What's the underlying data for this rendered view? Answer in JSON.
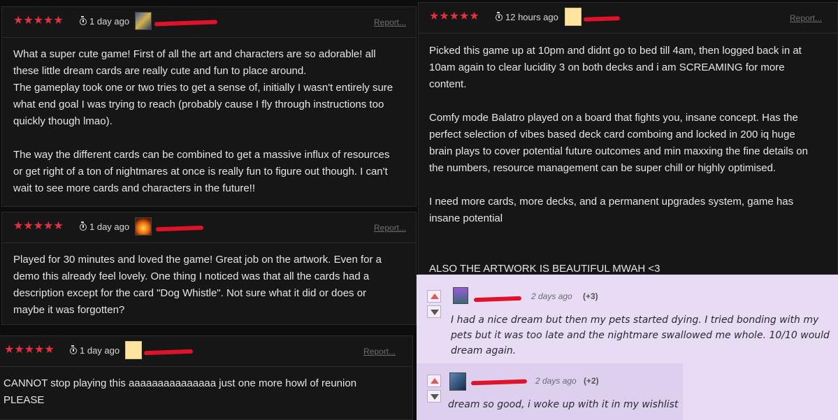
{
  "reviews": [
    {
      "stars": "★★★★★",
      "time": "1 day ago",
      "report": "Report...",
      "body": "What a super cute game! First of all the art and characters are so adorable! all\nthese little dream cards are really cute and fun to place around.\nThe gameplay took one or two tries to get a sense of, initially I wasn't entirely sure\nwhat end goal I was trying to reach (probably cause I fly through instructions too\nquickly though lmao).\n\nThe way the different cards can be combined to get a massive influx of resources\nor get right of a ton of nightmares at once is really fun to figure out though. I can't\nwait to see more cards and characters in the future!!"
    },
    {
      "stars": "★★★★★",
      "time": "1 day ago",
      "report": "Report...",
      "body": "Played for 30 minutes and loved the game! Great job on the artwork. Even for a\ndemo this already feel lovely. One thing I noticed was that all the cards had a\ndescription except for the card \"Dog Whistle\". Not sure what it did or does or\nmaybe it was forgotten?"
    },
    {
      "stars": "★★★★★",
      "time": "1 day ago",
      "report": "Report...",
      "body": "CANNOT stop playing this aaaaaaaaaaaaaaa just one more howl of reunion\nPLEASE"
    },
    {
      "stars": "★★★★★",
      "time": "12 hours ago",
      "report": "Report...",
      "body": "Picked this game up at 10pm and didnt go to bed till 4am, then logged back in at\n10am again to clear lucidity 3 on both decks and i am SCREAMING for more\ncontent.\n\nComfy mode Balatro played on a board that fights you, insane concept. Has the\nperfect selection of vibes based deck card comboing and locked in 200 iq huge\nbrain plays to cover potential future outcomes and min maxxing the fine details on\nthe numbers, resource management can be super chill or highly optimised.\n\nI need more cards, more decks, and a permanent upgrades system, game has\ninsane potential\n\n\nALSO THE ARTWORK IS BEAUTIFUL MWAH <3"
    }
  ],
  "comments": [
    {
      "time": "2 days ago",
      "score": "(+3)",
      "text": "I had a nice dream but then my pets started dying. I tried bonding with my\npets but it was too late and the nightmare swallowed me whole. 10/10 would\ndream again."
    },
    {
      "time": "2 days ago",
      "score": "(+2)",
      "text": "dream so good, i woke up with it in my wishlist"
    }
  ],
  "colors": {
    "star": "#e5303f",
    "redaction": "#e0122a",
    "comment_bg": "#e7dcf3"
  }
}
